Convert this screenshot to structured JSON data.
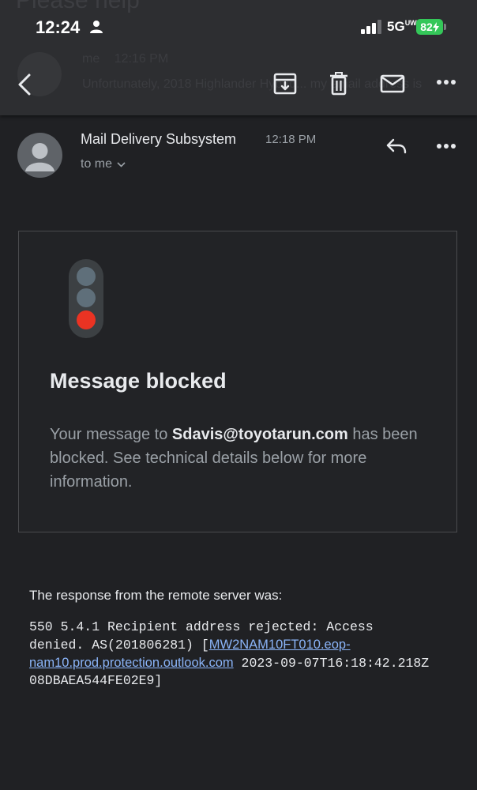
{
  "status_bar": {
    "time": "12:24",
    "network": "5G",
    "network_superscript": "UW",
    "battery": "82"
  },
  "background_thread": {
    "subject": "Please help",
    "sender": "me",
    "time": "12:16 PM",
    "snippet": "Unfortunately, 2018 Highlander Hybrid... my email address is"
  },
  "toolbar": {
    "back_icon": "back-arrow-icon",
    "archive_icon": "archive-icon",
    "delete_icon": "trash-icon",
    "mark_unread_icon": "mail-icon",
    "more_icon": "more-horizontal-icon"
  },
  "message": {
    "sender_name": "Mail Delivery Subsystem",
    "time": "12:18 PM",
    "recipient_label": "to me"
  },
  "card": {
    "title": "Message blocked",
    "body_prefix": "Your message to ",
    "email": "Sdavis@toyotarun.com",
    "body_suffix": " has been blocked. See technical details below for more information."
  },
  "response": {
    "intro": "The response from the remote server was:",
    "text_prefix": "550 5.4.1 Recipient address rejected: Access denied. AS(201806281) [",
    "link_text": "MW2NAM10FT010.eop-nam10.prod.protection.outlook.com",
    "text_suffix": " 2023-09-07T16:18:42.218Z 08DBAEA544FE02E9]"
  },
  "colors": {
    "background": "#202124",
    "toolbar": "#2d2e31",
    "battery": "#34c759",
    "link": "#8ab4f8",
    "traffic_light_red": "#ea3323"
  }
}
